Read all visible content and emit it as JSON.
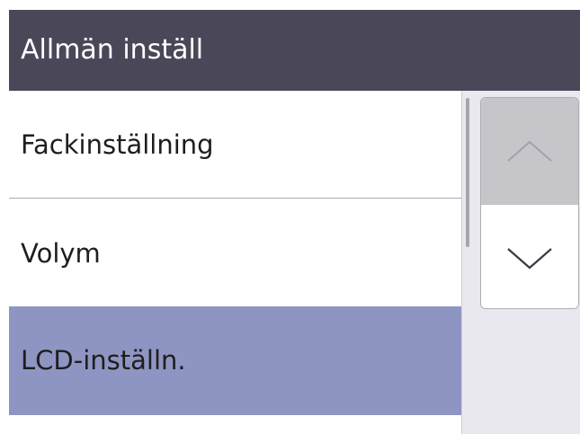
{
  "header": {
    "title": "Allmän inställ"
  },
  "menu": {
    "items": [
      {
        "label": "Fackinställning",
        "selected": false
      },
      {
        "label": "Volym",
        "selected": false
      },
      {
        "label": "LCD-inställn.",
        "selected": true
      }
    ]
  },
  "scroll": {
    "up_icon": "chevron-up-icon",
    "down_icon": "chevron-down-icon",
    "up_enabled": false,
    "down_enabled": true
  },
  "colors": {
    "header_bg": "#4a4759",
    "selected_bg": "#8f95c2",
    "disabled_button_bg": "#c6c5ca"
  }
}
